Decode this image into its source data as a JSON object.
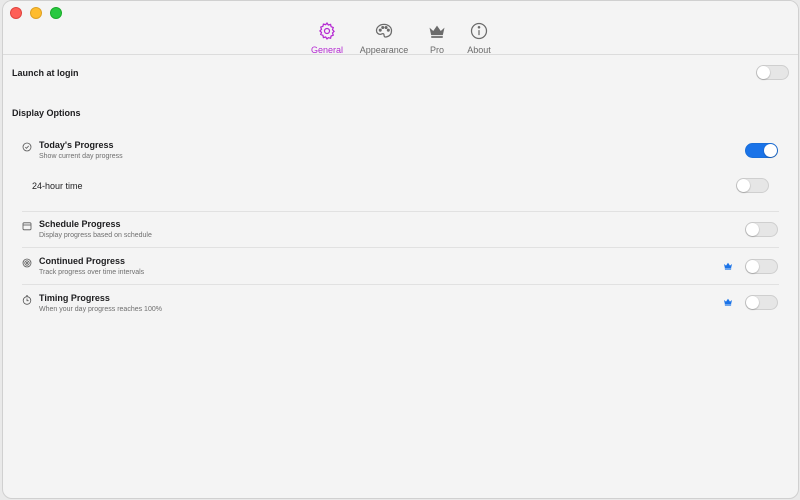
{
  "window": {
    "tabs": [
      {
        "label": "General",
        "icon": "gear-icon",
        "active": true
      },
      {
        "label": "Appearance",
        "icon": "palette-icon",
        "active": false
      },
      {
        "label": "Pro",
        "icon": "crown-icon",
        "active": false
      },
      {
        "label": "About",
        "icon": "info-icon",
        "active": false
      }
    ]
  },
  "general": {
    "launch_at_login": {
      "label": "Launch at login",
      "enabled": false
    },
    "display_options": {
      "title": "Display Options",
      "todays_progress": {
        "title": "Today's Progress",
        "subtitle": "Show current day progress",
        "enabled": true
      },
      "hour24": {
        "label": "24-hour time",
        "enabled": false
      },
      "schedule_progress": {
        "title": "Schedule Progress",
        "subtitle": "Display progress based on schedule",
        "enabled": false
      },
      "continued_progress": {
        "title": "Continued Progress",
        "subtitle": "Track progress over time intervals",
        "enabled": false,
        "pro": true
      },
      "timing_progress": {
        "title": "Timing Progress",
        "subtitle": "When your day progress reaches 100%",
        "enabled": false,
        "pro": true
      }
    }
  },
  "colors": {
    "accent": "#b52ad2",
    "toggle_on": "#1a73e8",
    "pro_badge": "#1a73e8"
  }
}
